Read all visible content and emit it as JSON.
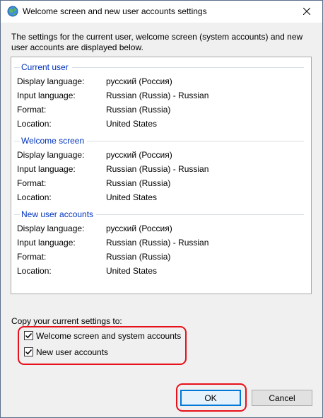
{
  "window": {
    "title": "Welcome screen and new user accounts settings"
  },
  "intro": "The settings for the current user, welcome screen (system accounts) and new user accounts are displayed below.",
  "labels": {
    "display_language": "Display language:",
    "input_language": "Input language:",
    "format": "Format:",
    "location": "Location:"
  },
  "groups": [
    {
      "title": "Current user",
      "display_language": "русский (Россия)",
      "input_language": "Russian (Russia) - Russian",
      "format": "Russian (Russia)",
      "location": "United States"
    },
    {
      "title": "Welcome screen",
      "display_language": "русский (Россия)",
      "input_language": "Russian (Russia) - Russian",
      "format": "Russian (Russia)",
      "location": "United States"
    },
    {
      "title": "New user accounts",
      "display_language": "русский (Россия)",
      "input_language": "Russian (Russia) - Russian",
      "format": "Russian (Russia)",
      "location": "United States"
    }
  ],
  "copy_settings": {
    "label": "Copy your current settings to:",
    "options": [
      {
        "label": "Welcome screen and system accounts",
        "checked": true
      },
      {
        "label": "New user accounts",
        "checked": true
      }
    ]
  },
  "buttons": {
    "ok": "OK",
    "cancel": "Cancel"
  },
  "colors": {
    "highlight": "#e8101a",
    "group_heading": "#0033bc",
    "focus_border": "#0078d7"
  },
  "icons": {
    "title": "globe-icon",
    "close": "close-icon",
    "check": "checkmark-icon"
  }
}
